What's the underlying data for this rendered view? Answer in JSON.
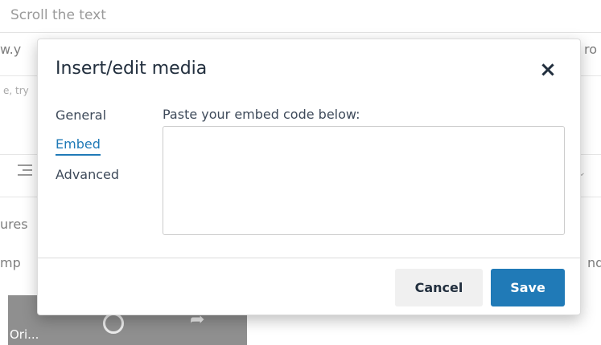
{
  "background": {
    "title_placeholder": "Scroll the text",
    "url_fragment": "w.y",
    "url_fragment_right": "ro",
    "hint_fragment": "e, try",
    "text_fragment_1": "ures",
    "text_fragment_2": "mp",
    "text_fragment_2_right": "nd",
    "video_title": "Ori..."
  },
  "dialog": {
    "title": "Insert/edit media",
    "close_icon": "×",
    "tabs": [
      {
        "label": "General",
        "active": false
      },
      {
        "label": "Embed",
        "active": true
      },
      {
        "label": "Advanced",
        "active": false
      }
    ],
    "embed": {
      "label": "Paste your embed code below:",
      "value": ""
    },
    "buttons": {
      "cancel": "Cancel",
      "save": "Save"
    }
  },
  "colors": {
    "accent": "#207ab7",
    "title_text": "#222f3e",
    "body_text": "#3e4a5a"
  }
}
